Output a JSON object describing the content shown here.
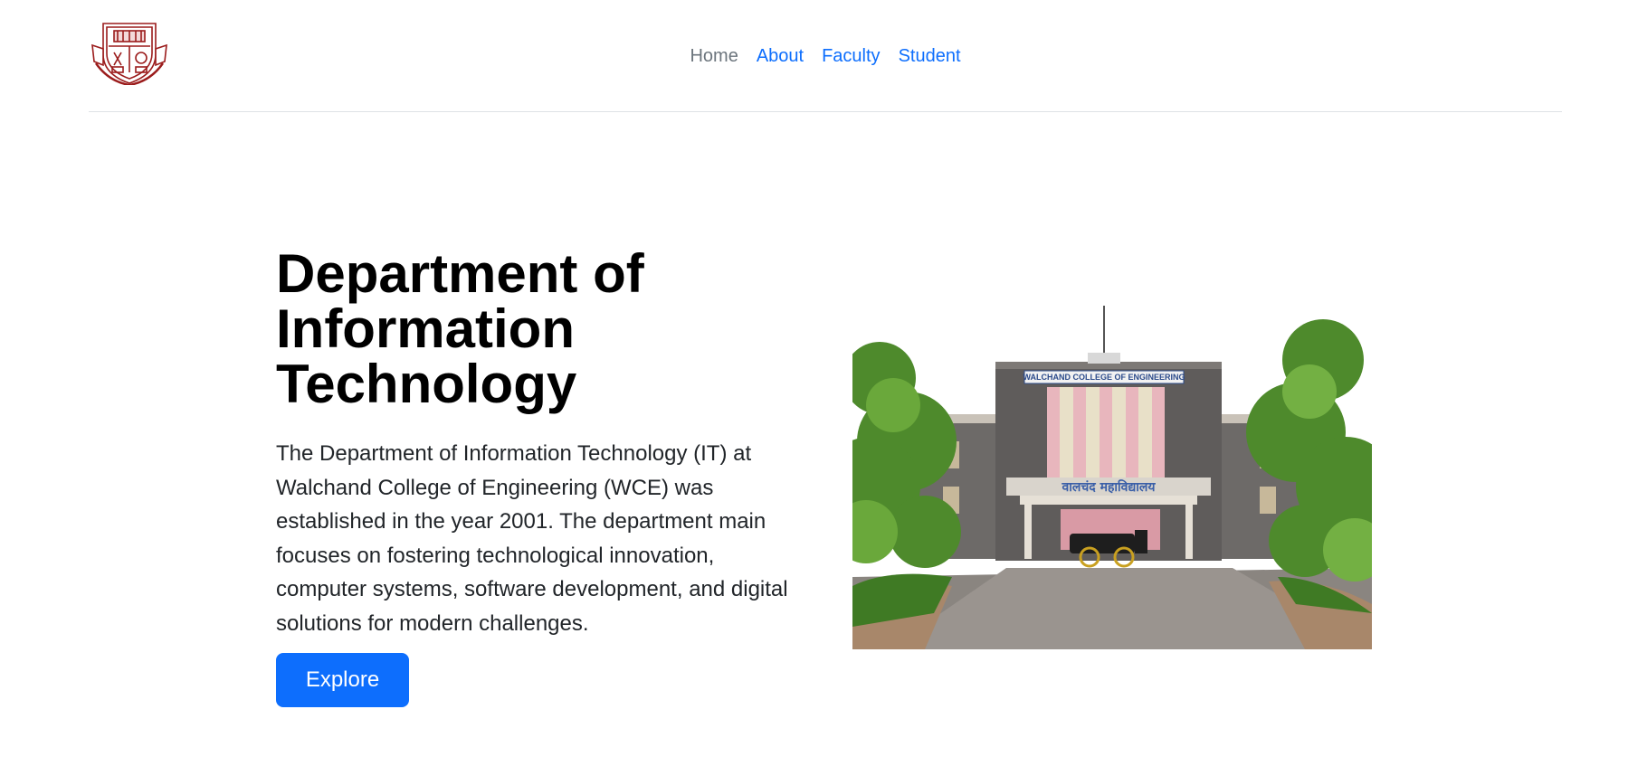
{
  "header": {
    "logo_icon": "college-crest-icon",
    "nav": [
      {
        "label": "Home",
        "active": true
      },
      {
        "label": "About",
        "active": false
      },
      {
        "label": "Faculty",
        "active": false
      },
      {
        "label": "Student",
        "active": false
      }
    ]
  },
  "hero": {
    "title_lines": [
      "Department of",
      "Information",
      "Technology"
    ],
    "description": "The Department of Information Technology (IT) at Walchand College of Engineering (WCE) was established in the year 2001. The department main focuses on fostering technological innovation, computer systems, software development, and digital solutions for modern challenges.",
    "button_label": "Explore",
    "image": {
      "sign_text": "WALCHAND COLLEGE OF ENGINEERING",
      "marathi_text": "वालचंद महाविद्यालय"
    }
  },
  "colors": {
    "link": "#0d6efd",
    "active_link": "#6c757d",
    "button": "#0d6efd",
    "crest": "#9b1c1c"
  }
}
